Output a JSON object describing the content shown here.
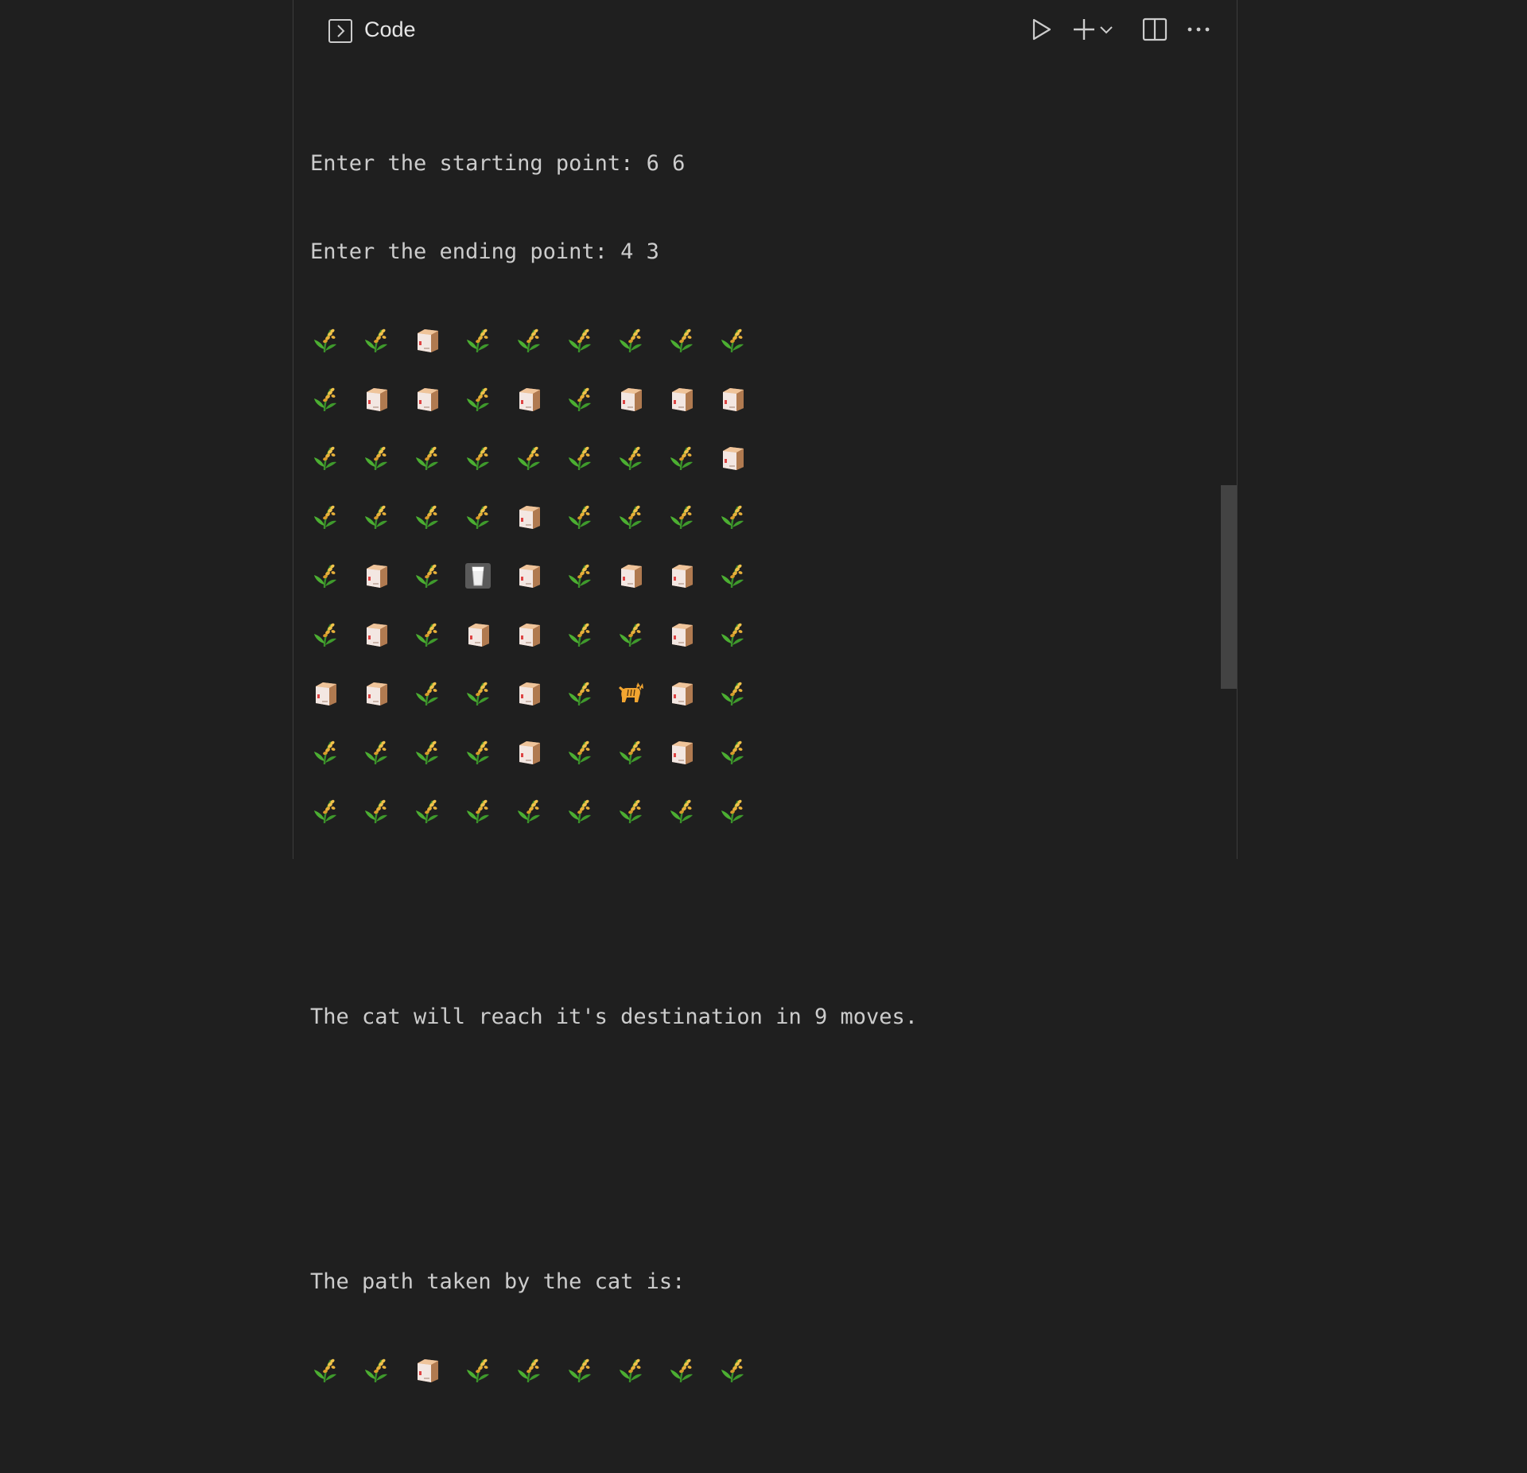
{
  "header": {
    "title": "Code"
  },
  "output": {
    "prompt_start": "Enter the starting point: 6 6",
    "prompt_end": "Enter the ending point: 4 3",
    "result": "The cat will reach it's destination in 9 moves.",
    "path_label": "The path taken by the cat is:"
  },
  "legend": {
    "W": "crop-icon",
    "B": "box-icon",
    "M": "milk-glass-icon",
    "C": "cat-icon"
  },
  "grid": [
    "WWBWWWWWW",
    "WBBWBWBBB",
    "WWWWWWWWB",
    "WWWWBWWWW",
    "WBWMBWBBW",
    "WBWBBWWBW",
    "BBWWBWCBW",
    "WWWWBWWBW",
    "WWWWWWWWW"
  ],
  "path_grid_first_row": "WWBWWWWWW"
}
